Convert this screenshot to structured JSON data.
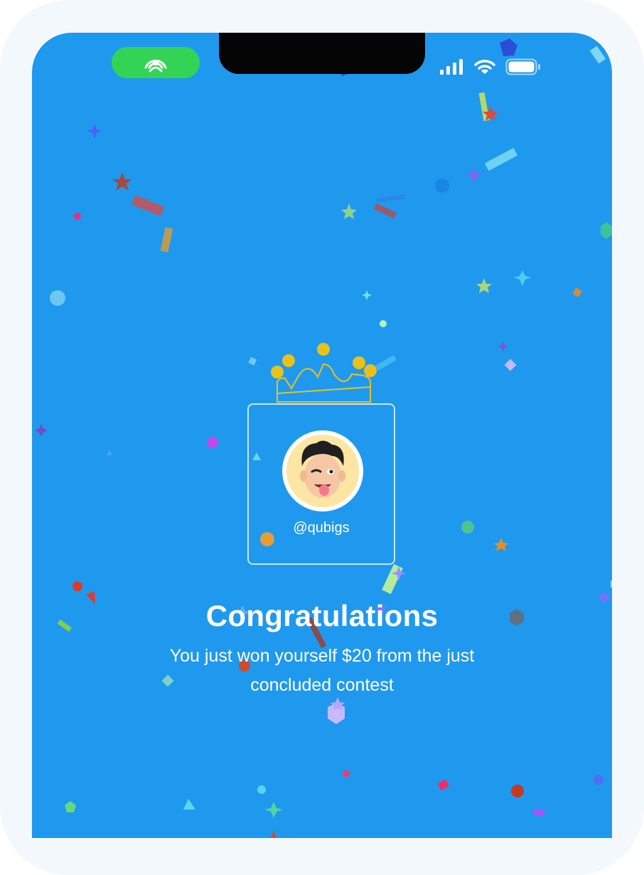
{
  "winner": {
    "username": "@qubigs"
  },
  "headline": "Congratulations",
  "message": "You just won yourself $20 from the just concluded contest",
  "colors": {
    "screen_background": "#1f99ee",
    "live_pill": "#33d456",
    "crown": "#e8c21b",
    "avatar_background": "#fde5a3"
  },
  "icons": {
    "live_pill": "broadcast-person-icon",
    "status": [
      "cellular-signal-icon",
      "wifi-icon",
      "battery-icon"
    ],
    "decorations": [
      "crown-icon",
      "confetti"
    ]
  }
}
